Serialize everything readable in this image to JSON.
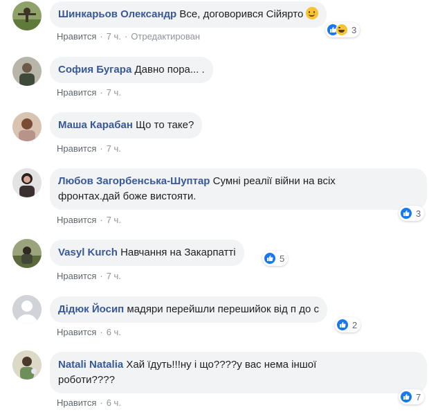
{
  "comments": [
    {
      "author": "Шинкарьов Олександр",
      "text": "Все, договорився Сійярто",
      "like": "Нравится",
      "time": "7 ч.",
      "edited": "Отредактирован",
      "reactions": "3"
    },
    {
      "author": "София Бугара",
      "text": "Давно пора... .",
      "like": "Нравится",
      "time": "7 ч."
    },
    {
      "author": "Маша Карабан",
      "text": "Що то таке?",
      "like": "Нравится",
      "time": "7 ч."
    },
    {
      "author": "Любов Загорбенська-Шуптар",
      "text_line1": "Сумні реалії війни на всіх",
      "text_line2": "фронтах.дай боже вистояти.",
      "like": "Нравится",
      "time": "7 ч.",
      "reactions": "3"
    },
    {
      "author": "Vasyl Kurch",
      "text": "Навчання на Закарпатті",
      "like": "Нравится",
      "time": "7 ч.",
      "reactions": "5"
    },
    {
      "author": "Дідюк Йосип",
      "text": "мадяри перейшли перешийок від п до с",
      "like": "Нравится",
      "time": "6 ч.",
      "reactions": "2"
    },
    {
      "author": "Natali Natalia",
      "text_line1": "Хай їдуть!!!ну і що????у вас нема іншої",
      "text_line2": "роботи????",
      "like": "Нравится",
      "time": "6 ч.",
      "reactions": "7"
    }
  ],
  "separator": "·",
  "colors": {
    "author": "#385898",
    "bubble": "#f2f3f5",
    "like_blue": "#1877f2"
  }
}
